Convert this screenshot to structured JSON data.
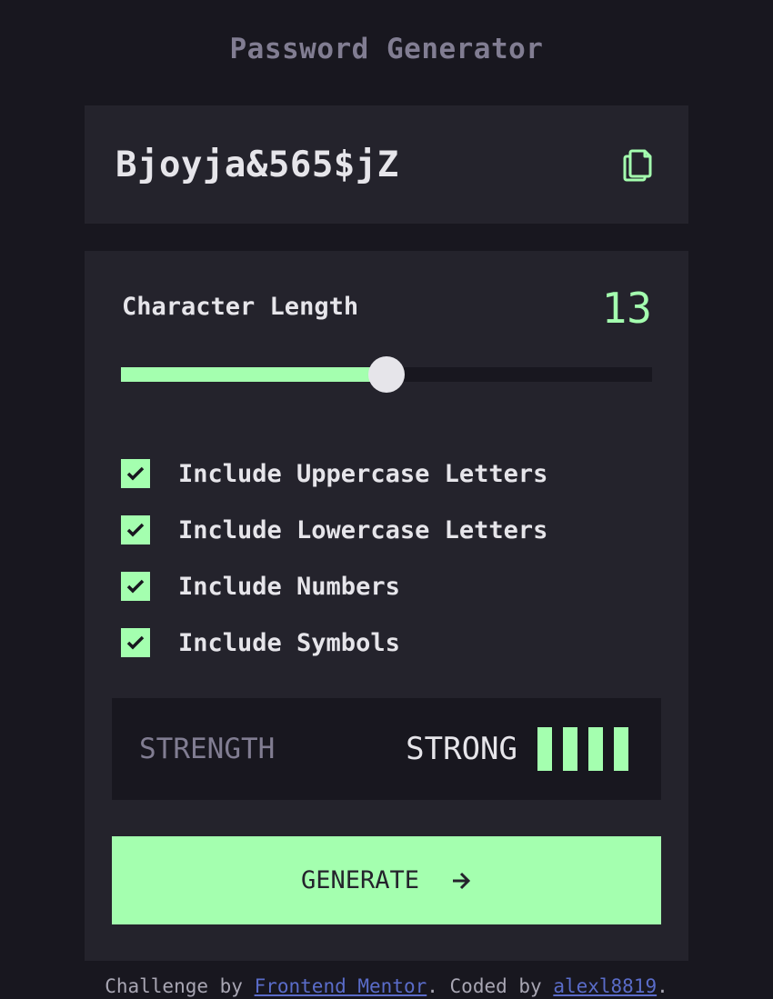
{
  "app": {
    "title": "Password Generator"
  },
  "password": {
    "value": "Bjoyja&565$jZ"
  },
  "length": {
    "label": "Character Length",
    "value": "13",
    "min": 0,
    "max": 26,
    "fraction": 0.5
  },
  "options": [
    {
      "label": "Include Uppercase Letters",
      "checked": true
    },
    {
      "label": "Include Lowercase Letters",
      "checked": true
    },
    {
      "label": "Include Numbers",
      "checked": true
    },
    {
      "label": "Include Symbols",
      "checked": true
    }
  ],
  "strength": {
    "label": "STRENGTH",
    "value": "STRONG",
    "level": 4,
    "max_level": 4
  },
  "generate": {
    "label": "GENERATE"
  },
  "footer": {
    "prefix": "Challenge by ",
    "link1": "Frontend Mentor",
    "middle": ". Coded by ",
    "link2": "alexl8819",
    "suffix": "."
  },
  "colors": {
    "accent": "#a4ffaf",
    "panel": "#24232c",
    "background": "#18171f",
    "muted": "#817d92"
  },
  "icons": {
    "copy": "copy-icon",
    "check": "check-icon",
    "arrow": "arrow-right-icon"
  }
}
